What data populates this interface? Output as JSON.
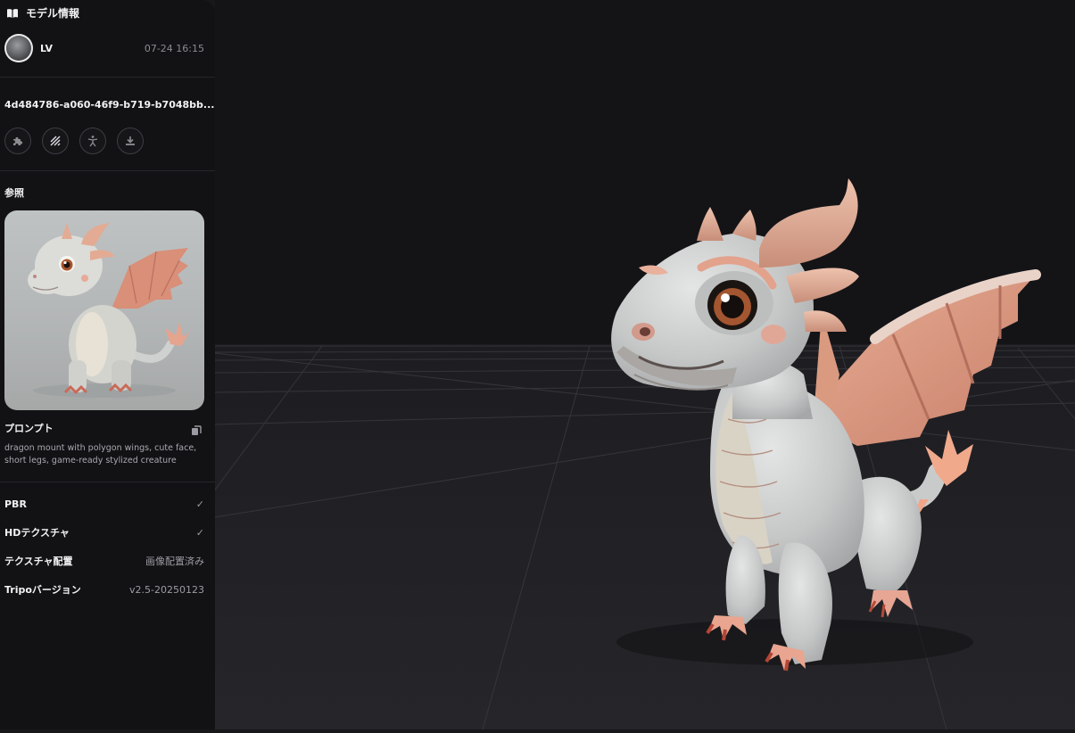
{
  "sidebar": {
    "header_title": "モデル情報",
    "user": {
      "name": "LV",
      "date": "07-24 16:15"
    },
    "model_id": "4d484786-a060-46f9-b719-b7048bb...",
    "tools": [
      {
        "icon": "puzzle-icon"
      },
      {
        "icon": "hatch-texture-icon"
      },
      {
        "icon": "rig-figure-icon"
      },
      {
        "icon": "download-icon"
      }
    ],
    "reference_title": "参照",
    "prompt_title": "プロンプト",
    "prompt_text": "dragon mount with polygon wings, cute face, short legs, game-ready stylized creature",
    "properties": [
      {
        "label": "PBR",
        "value": "✓"
      },
      {
        "label": "HDテクスチャ",
        "value": "✓"
      },
      {
        "label": "テクスチャ配置",
        "value": "画像配置済み"
      },
      {
        "label": "Tripoバージョン",
        "value": "v2.5-20250123"
      }
    ]
  },
  "colors": {
    "sidebar_bg": "#121215",
    "viewport_bg": "#18181b",
    "dragon_skin": "#c9cbcb",
    "dragon_wing": "#d99a80",
    "dragon_horn": "#d8a08a"
  }
}
